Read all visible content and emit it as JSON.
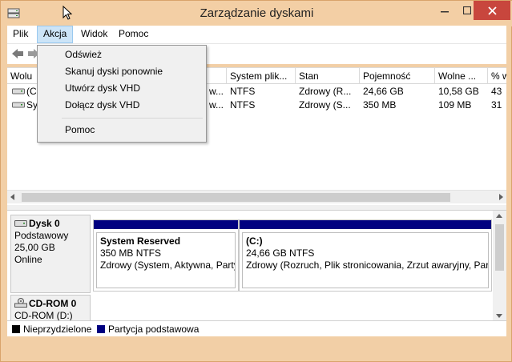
{
  "window": {
    "title": "Zarządzanie dyskami"
  },
  "menubar": {
    "items": [
      {
        "label": "Plik"
      },
      {
        "label": "Akcja"
      },
      {
        "label": "Widok"
      },
      {
        "label": "Pomoc"
      }
    ],
    "active": "Akcja"
  },
  "action_menu": {
    "items": [
      {
        "label": "Odśwież"
      },
      {
        "label": "Skanuj dyski ponownie"
      },
      {
        "label": "Utwórz dysk VHD"
      },
      {
        "label": "Dołącz dysk VHD"
      },
      {
        "label": "Pomoc"
      }
    ]
  },
  "volume_list": {
    "columns": [
      "Wolu",
      "System plik...",
      "Stan",
      "Pojemność",
      "Wolne ...",
      "% w"
    ],
    "rows": [
      {
        "volume": "(C",
        "layout_tail": "w...",
        "fs": "NTFS",
        "status": "Zdrowy (R...",
        "capacity": "24,66 GB",
        "free": "10,58 GB",
        "pct": "43"
      },
      {
        "volume": "Sys",
        "layout_tail": "w...",
        "fs": "NTFS",
        "status": "Zdrowy (S...",
        "capacity": "350 MB",
        "free": "109 MB",
        "pct": "31"
      }
    ]
  },
  "disks": [
    {
      "name": "Dysk 0",
      "type": "Podstawowy",
      "size": "25,00 GB",
      "state": "Online",
      "partitions": [
        {
          "name": "System Reserved",
          "size": "350 MB NTFS",
          "status": "Zdrowy (System, Aktywna, Party"
        },
        {
          "name": "(C:)",
          "size": "24,66 GB NTFS",
          "status": "Zdrowy (Rozruch, Plik stronicowania, Zrzut awaryjny, Par"
        }
      ]
    },
    {
      "name": "CD-ROM 0",
      "drive": "CD-ROM (D:)"
    }
  ],
  "legend": {
    "items": [
      {
        "label": "Nieprzydzielone",
        "color": "#000000"
      },
      {
        "label": "Partycja podstawowa",
        "color": "#000080"
      }
    ]
  },
  "colors": {
    "window_frame": "#f2cfa6",
    "close_button": "#c8463d",
    "primary_partition": "#000080",
    "menu_highlight": "#cce4f7"
  }
}
